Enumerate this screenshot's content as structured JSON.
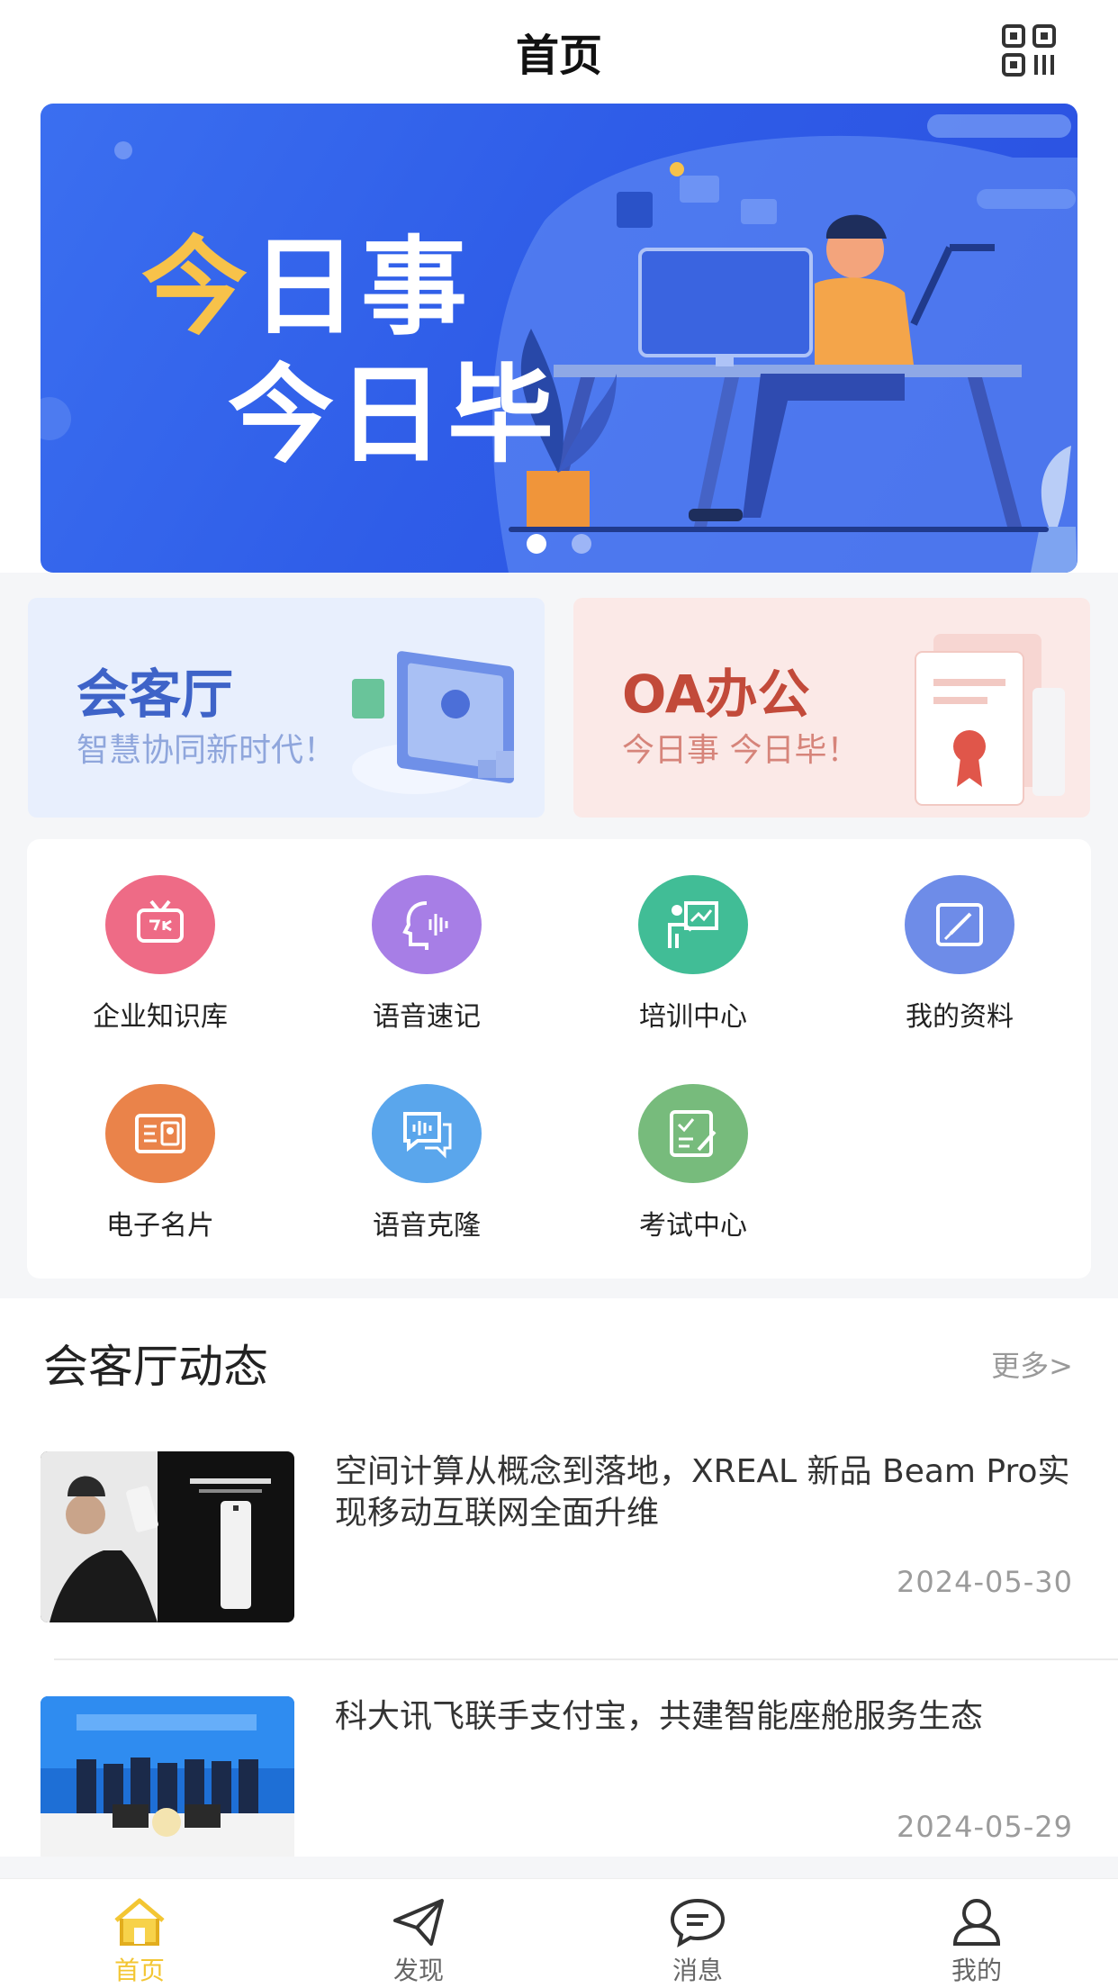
{
  "header": {
    "title": "首页",
    "qr_icon": "qr-code-icon"
  },
  "banner": {
    "line1_highlight": "今",
    "line1_rest": "日事",
    "line2": "今日毕",
    "slides": 2,
    "active_slide": 1
  },
  "promos": [
    {
      "title": "会客厅",
      "subtitle": "智慧协同新时代！"
    },
    {
      "title": "OA办公",
      "subtitle": "今日事 今日毕！"
    }
  ],
  "grid": [
    {
      "label": "企业知识库",
      "icon": "tv-icon",
      "color": "#ee6b86"
    },
    {
      "label": "语音速记",
      "icon": "voice-head-icon",
      "color": "#a77ee6"
    },
    {
      "label": "培训中心",
      "icon": "training-icon",
      "color": "#41bd96"
    },
    {
      "label": "我的资料",
      "icon": "edit-icon",
      "color": "#6e8ce8"
    },
    {
      "label": "电子名片",
      "icon": "card-icon",
      "color": "#ea834a"
    },
    {
      "label": "语音克隆",
      "icon": "voice-chat-icon",
      "color": "#5aa6ec"
    },
    {
      "label": "考试中心",
      "icon": "exam-icon",
      "color": "#77bb7c"
    }
  ],
  "news": {
    "title": "会客厅动态",
    "more": "更多>",
    "items": [
      {
        "headline": "空间计算从概念到落地，XREAL 新品 Beam Pro实现移动互联网全面升维",
        "date": "2024-05-30"
      },
      {
        "headline": "科大讯飞联手支付宝，共建智能座舱服务生态",
        "date": "2024-05-29"
      }
    ]
  },
  "tabs": [
    {
      "label": "首页",
      "icon": "home-icon",
      "active": true
    },
    {
      "label": "发现",
      "icon": "paper-plane-icon",
      "active": false
    },
    {
      "label": "消息",
      "icon": "message-icon",
      "active": false
    },
    {
      "label": "我的",
      "icon": "user-icon",
      "active": false
    }
  ],
  "colors": {
    "accent": "#f3c633",
    "banner": "#2f5de8"
  }
}
